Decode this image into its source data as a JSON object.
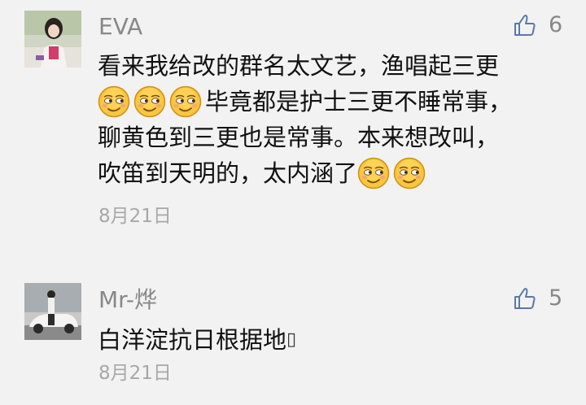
{
  "comments": [
    {
      "username": "EVA",
      "likes": "6",
      "lines": [
        {
          "text": "看来我给改的群名太文艺，渔唱起三更"
        },
        {
          "text": "毕竟都是护士三更不睡常事，"
        },
        {
          "text": "聊黄色到三更也是常事。本来想改叫，"
        },
        {
          "text": "吹笛到天明的，太内涵了"
        }
      ],
      "emojis": [
        "smirk-emoji",
        "smirk-emoji",
        "smirk-emoji",
        "smirk-emoji",
        "smirk-emoji"
      ],
      "date": "8月21日",
      "avatar": "avatar-photo-woman"
    },
    {
      "username": "Mr-烨",
      "likes": "5",
      "text": "白洋淀抗日根据地",
      "trailing_glyph": "▯",
      "date": "8月21日",
      "avatar": "avatar-photo-man-with-car"
    }
  ],
  "colors": {
    "background": "#f2f2f2",
    "username": "#888888",
    "text": "#111111",
    "date": "#a8a8a8",
    "like_icon": "#5a78a8"
  },
  "icons": {
    "like": "thumbs-up-icon"
  }
}
